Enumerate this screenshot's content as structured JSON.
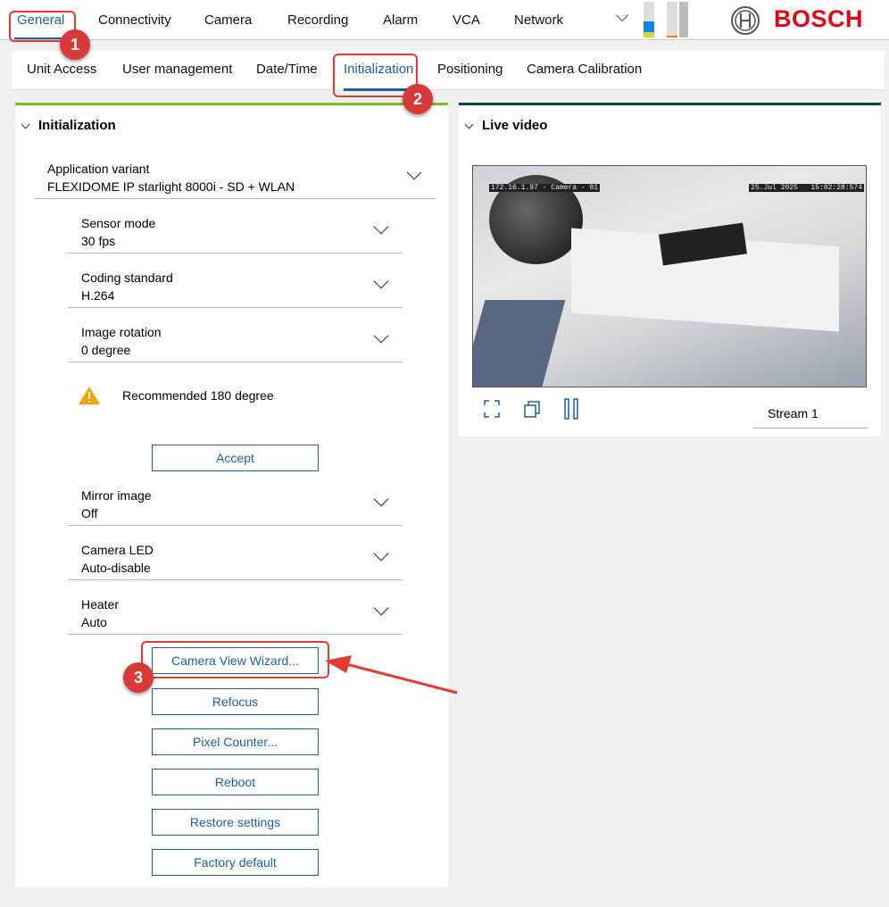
{
  "top_tabs": [
    "General",
    "Connectivity",
    "Camera",
    "Recording",
    "Alarm",
    "VCA",
    "Network"
  ],
  "brand": "BOSCH",
  "sub_tabs": [
    "Unit Access",
    "User management",
    "Date/Time",
    "Initialization",
    "Positioning",
    "Camera Calibration"
  ],
  "init": {
    "title": "Initialization",
    "app_variant": {
      "label": "Application variant",
      "value": "FLEXIDOME IP starlight 8000i - SD + WLAN"
    },
    "fields": [
      {
        "label": "Sensor mode",
        "value": "30 fps"
      },
      {
        "label": "Coding standard",
        "value": "H.264"
      },
      {
        "label": "Image rotation",
        "value": "0 degree"
      }
    ],
    "warning": "Recommended 180 degree",
    "accept": "Accept",
    "fields2": [
      {
        "label": "Mirror image",
        "value": "Off"
      },
      {
        "label": "Camera LED",
        "value": "Auto-disable"
      },
      {
        "label": "Heater",
        "value": "Auto"
      }
    ],
    "buttons": [
      "Camera View Wizard...",
      "Refocus",
      "Pixel Counter...",
      "Reboot",
      "Restore settings",
      "Factory default"
    ]
  },
  "live": {
    "title": "Live video",
    "overlay_left": "172.16.1.97 - Camera - 01",
    "overlay_right": "25.Jul 2025   15:02:28:574",
    "stream": "Stream 1"
  },
  "annotations": [
    "1",
    "2",
    "3"
  ],
  "colors": {
    "accent": "#1d5f9f",
    "brand": "#e20015",
    "green": "#78be20",
    "annotation": "#e53935"
  }
}
